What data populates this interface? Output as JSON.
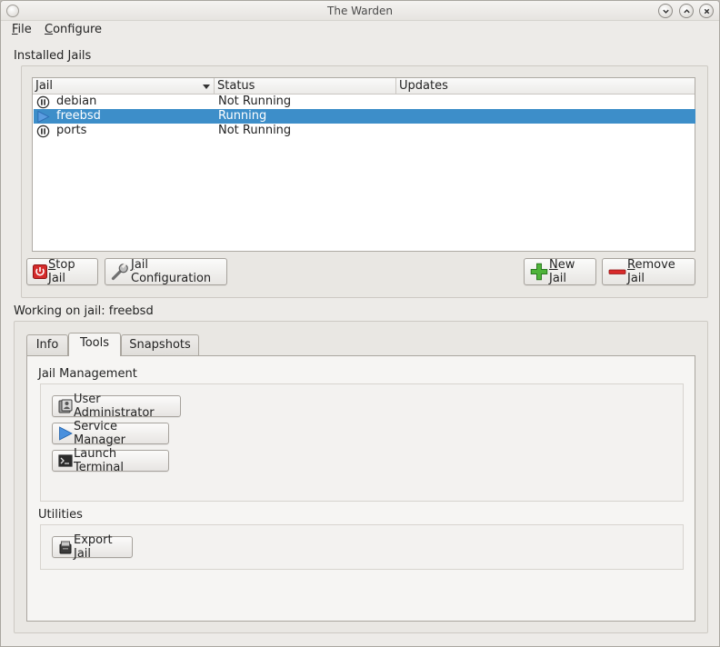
{
  "window": {
    "title": "The Warden"
  },
  "menu": [
    {
      "label": "File",
      "mnemonic": "F",
      "rest": "ile"
    },
    {
      "label": "Configure",
      "mnemonic": "C",
      "rest": "onfigure"
    }
  ],
  "installed": {
    "label": "Installed Jails",
    "columns": [
      "Jail",
      "Status",
      "Updates"
    ],
    "rows": [
      {
        "name": "debian",
        "status": "Not Running",
        "updates": "",
        "icon": "pause-icon",
        "selected": false
      },
      {
        "name": "freebsd",
        "status": "Running",
        "updates": "",
        "icon": "play-icon",
        "selected": true
      },
      {
        "name": "ports",
        "status": "Not Running",
        "updates": "",
        "icon": "pause-icon",
        "selected": false
      }
    ]
  },
  "buttons": {
    "stop_jail": {
      "mnemonic": "S",
      "rest": "top Jail",
      "icon": "power-icon"
    },
    "jail_config": {
      "mnemonic": "J",
      "rest": "ail Configuration",
      "icon": "wrench-icon"
    },
    "new_jail": {
      "mnemonic": "N",
      "rest": "ew Jail",
      "icon": "plus-icon"
    },
    "remove_jail": {
      "mnemonic": "R",
      "rest": "emove Jail",
      "icon": "minus-icon"
    }
  },
  "working": {
    "label": "Working on jail: freebsd"
  },
  "tabs": [
    {
      "label": "Info",
      "active": false
    },
    {
      "label": "Tools",
      "active": true
    },
    {
      "label": "Snapshots",
      "active": false
    }
  ],
  "tools": {
    "jail_management": {
      "label": "Jail Management",
      "buttons": [
        {
          "label": "User Administrator",
          "icon": "users-icon"
        },
        {
          "label": "Service Manager",
          "icon": "play-icon"
        },
        {
          "label": "Launch Terminal",
          "icon": "terminal-icon"
        }
      ]
    },
    "utilities": {
      "label": "Utilities",
      "buttons": [
        {
          "label": "Export Jail",
          "icon": "export-icon"
        }
      ]
    }
  },
  "colors": {
    "selection": "#3d8ec9",
    "window_bg": "#edebe8"
  }
}
